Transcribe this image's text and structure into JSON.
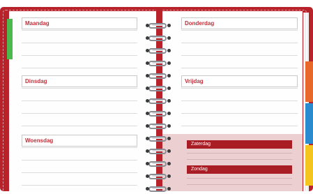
{
  "planner": {
    "days": {
      "monday": "Maandag",
      "tuesday": "Dinsdag",
      "wednesday": "Woensdag",
      "thursday": "Donderdag",
      "friday": "Vrijdag",
      "saturday": "Zaterdag",
      "sunday": "Zondag"
    },
    "colors": {
      "cover": "#b8222a",
      "day_text": "#c0303a",
      "weekend_bg": "#eccfd0",
      "weekend_bar": "#a91e25",
      "tab_green": "#4cb94c",
      "tab_orange": "#e8672a",
      "tab_blue": "#2a8ccf",
      "tab_yellow": "#f4c51f"
    }
  }
}
